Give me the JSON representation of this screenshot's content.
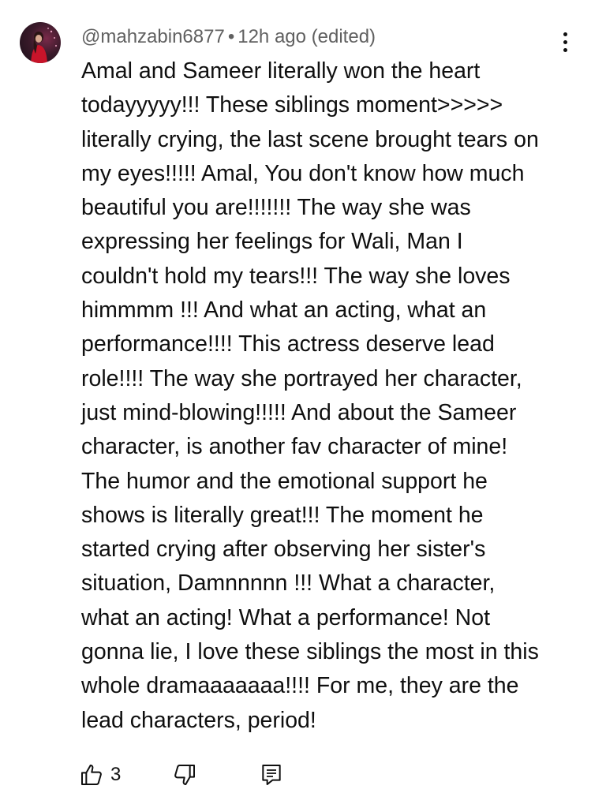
{
  "comment": {
    "author": "@mahzabin6877",
    "separator": "•",
    "timestamp": "12h ago (edited)",
    "lines": [
      "Amal and Sameer literally won the heart",
      "todayyyyy!!! These siblings moment>>>>>",
      "literally crying, the last scene brought tears on",
      "my eyes!!!!! Amal, You don't know how much",
      "beautiful you are!!!!!!! The way she was",
      "expressing her feelings for Wali, Man I",
      "couldn't hold my tears!!! The way she loves",
      "himmmm !!! And what an acting, what an",
      "performance!!!! This actress deserve lead",
      "role!!!! The way she portrayed her character,",
      "just mind-blowing!!!!! And about the  Sameer",
      "character, is another fav character of mine!",
      "The humor and the emotional support he",
      "shows is literally great!!! The moment he",
      "started crying after observing her sister's",
      "situation, Damnnnnn !!! What a character,",
      "what an acting! What a performance! Not",
      "gonna lie, I love these siblings the most in this",
      "whole dramaaaaaaa!!!! For me, they are the",
      "lead characters, period!"
    ],
    "like_count": "3"
  },
  "icons": {
    "more": "more-vert-icon",
    "like": "thumbs-up-icon",
    "dislike": "thumbs-down-icon",
    "reply": "reply-comment-icon"
  }
}
